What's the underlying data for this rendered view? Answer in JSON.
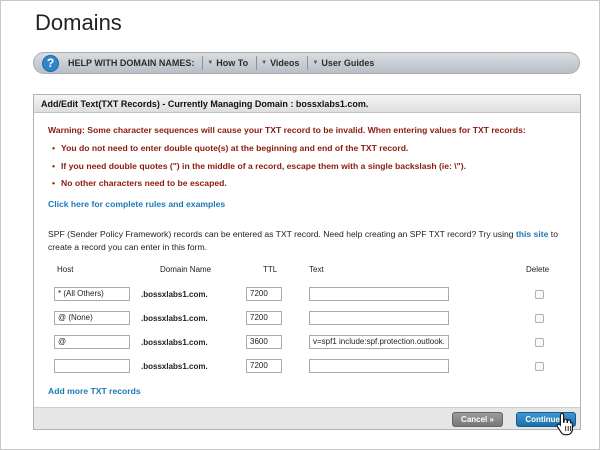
{
  "page": {
    "title": "Domains"
  },
  "help_bar": {
    "label": "HELP WITH DOMAIN NAMES:",
    "links": [
      "How To",
      "Videos",
      "User Guides"
    ]
  },
  "panel": {
    "title": "Add/Edit Text(TXT Records) - Currently Managing Domain : bossxlabs1.com.",
    "warning": "Warning: Some character sequences will cause your TXT record to be invalid. When entering values for TXT records:",
    "bullets": [
      "You do not need to enter double quote(s) at the beginning and end of the TXT record.",
      "If you need double quotes (\") in the middle of a record, escape them with a single backslash (ie: \\\").",
      "No other characters need to be escaped."
    ],
    "rules_link": "Click here for complete rules and examples",
    "spf_text_1": "SPF (Sender Policy Framework) records can be entered as TXT record. Need help creating an SPF TXT record? Try using ",
    "spf_link": "this site",
    "spf_text_2": " to create a record you can enter in this form.",
    "columns": {
      "host": "Host",
      "domain": "Domain Name",
      "ttl": "TTL",
      "text": "Text",
      "delete": "Delete"
    },
    "rows": [
      {
        "host": "* (All Others)",
        "domain": ".bossxlabs1.com.",
        "ttl": "7200",
        "text": "",
        "delete": false
      },
      {
        "host": "@ (None)",
        "domain": ".bossxlabs1.com.",
        "ttl": "7200",
        "text": "",
        "delete": false
      },
      {
        "host": "@",
        "domain": ".bossxlabs1.com.",
        "ttl": "3600",
        "text": "v=spf1 include:spf.protection.outlook.",
        "delete": false
      },
      {
        "host": "",
        "domain": ".bossxlabs1.com.",
        "ttl": "7200",
        "text": "",
        "delete": false
      }
    ],
    "add_more": "Add more TXT records"
  },
  "buttons": {
    "cancel": "Cancel »",
    "continue": "Continue »"
  },
  "colors": {
    "warning": "#8b1a0e",
    "link": "#1b7ab8",
    "continue_button": "#2a83c0",
    "help_icon": "#2f86c8"
  }
}
